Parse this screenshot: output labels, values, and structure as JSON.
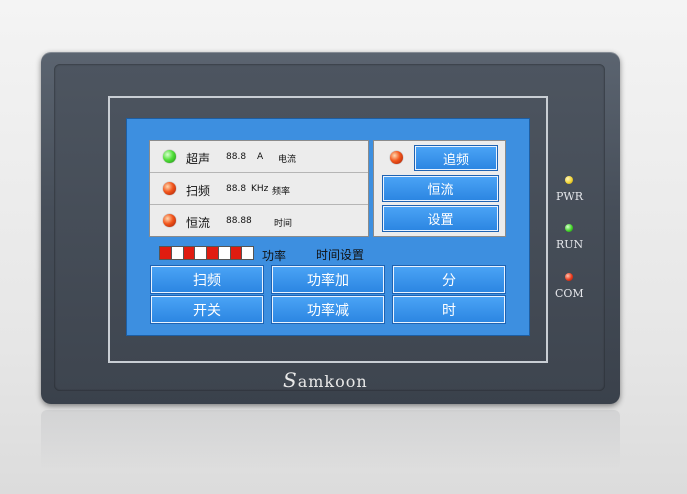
{
  "left_panel": {
    "rows": [
      {
        "led": "green",
        "name": "超声",
        "value": "88.8",
        "unit": "A",
        "desc": "电流"
      },
      {
        "led": "red",
        "name": "扫频",
        "value": "88.8",
        "unit": "KHz",
        "desc": "频率"
      },
      {
        "led": "red",
        "name": "恒流",
        "value": "88.88",
        "unit": "",
        "desc": "时间"
      }
    ]
  },
  "right_panel": {
    "led": "red",
    "track_label": "追频",
    "constant_label": "恒流",
    "settings_label": "设置"
  },
  "power_bar": {
    "segments": [
      "on",
      "off",
      "on",
      "off",
      "on",
      "off",
      "on",
      "off"
    ],
    "label": "功率"
  },
  "time_setting_label": "时间设置",
  "buttons": {
    "sweep": "扫频",
    "power_up": "功率加",
    "minute": "分",
    "switch": "开关",
    "power_down": "功率减",
    "hour": "时"
  },
  "brand": {
    "first": "S",
    "rest": "amkoon"
  },
  "indicators": [
    {
      "label": "PWR",
      "color": "yellow"
    },
    {
      "label": "RUN",
      "color": "green"
    },
    {
      "label": "COM",
      "color": "red"
    }
  ]
}
